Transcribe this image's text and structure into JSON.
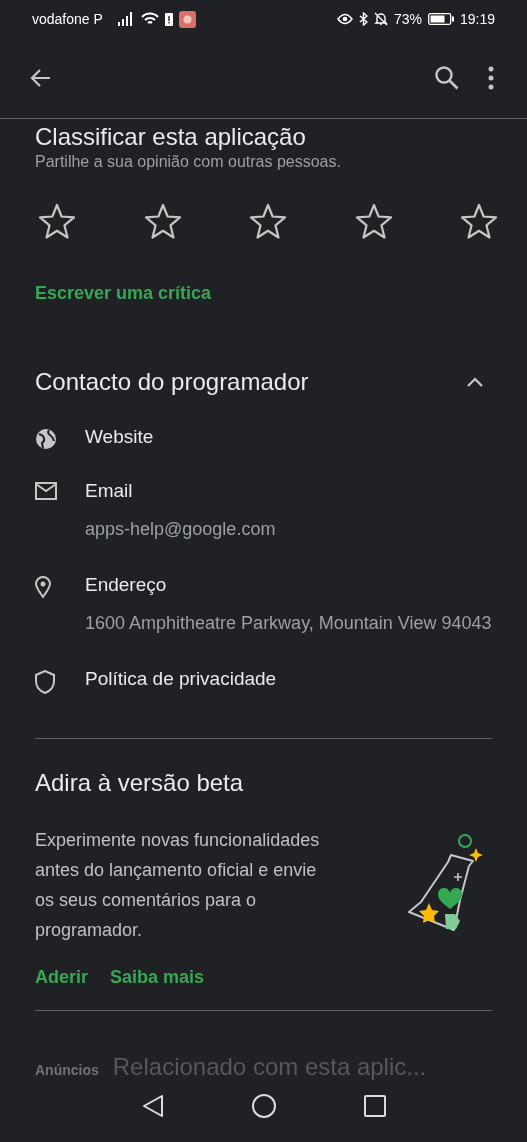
{
  "status_bar": {
    "carrier": "vodafone P",
    "battery_percent": "73%",
    "time": "19:19"
  },
  "rating": {
    "title": "Classificar esta aplicação",
    "subtitle": "Partilhe a sua opinião com outras pessoas.",
    "stars": 0,
    "write_review": "Escrever uma crítica"
  },
  "developer_contact": {
    "title": "Contacto do programador",
    "expanded": true,
    "items": [
      {
        "kind": "globe",
        "label": "Website"
      },
      {
        "kind": "mail",
        "label": "Email",
        "detail": "apps-help@google.com"
      },
      {
        "kind": "pin",
        "label": "Endereço",
        "detail": "1600 Amphitheatre Parkway, Mountain View 94043"
      },
      {
        "kind": "shield",
        "label": "Política de privacidade"
      }
    ]
  },
  "beta": {
    "title": "Adira à versão beta",
    "text": "Experimente novas funcionalidades antes do lançamento oficial e envie os seus comentários para o programador.",
    "actions": [
      "Aderir",
      "Saiba mais"
    ]
  },
  "bottom": {
    "ads_label": "Anúncios",
    "title": "Relacionado com esta aplic..."
  }
}
